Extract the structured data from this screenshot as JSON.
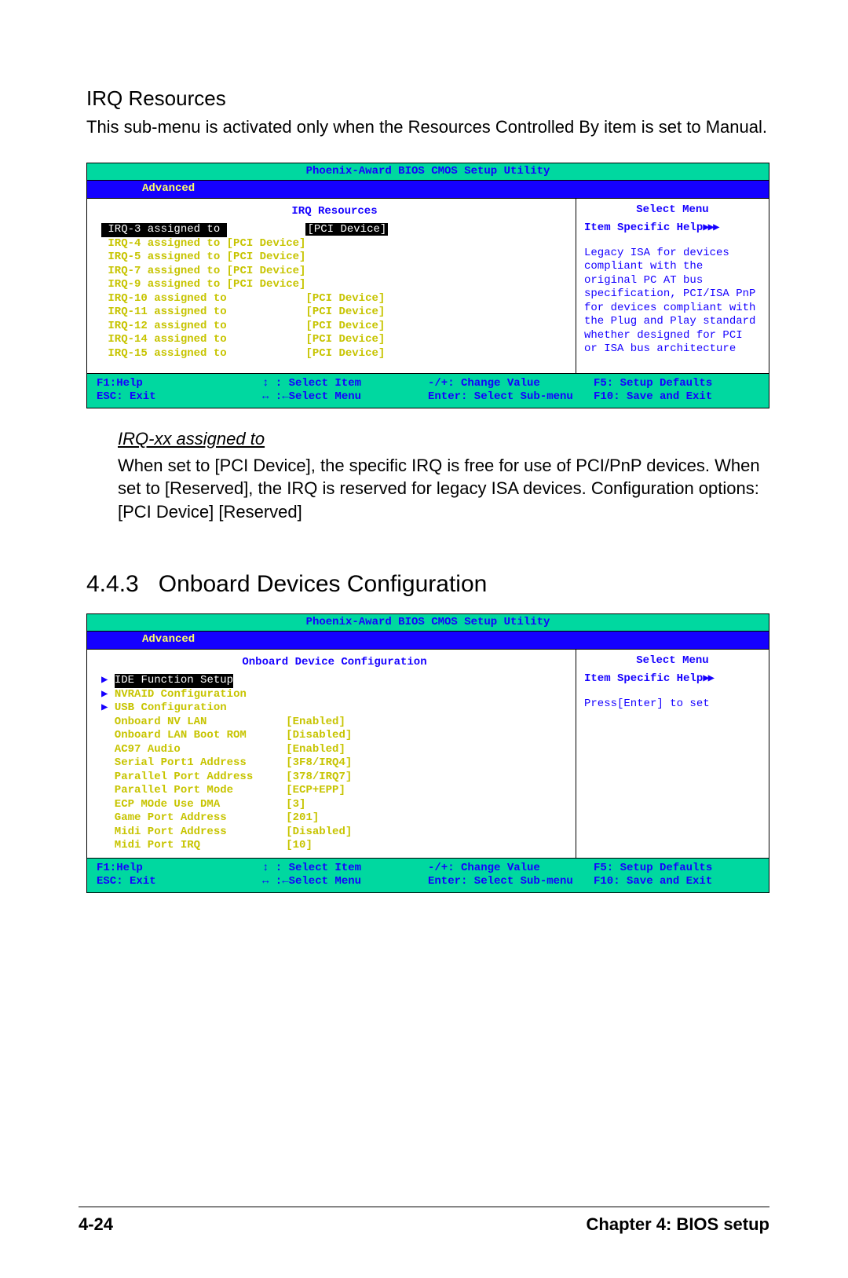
{
  "section1": {
    "title": "IRQ Resources",
    "intro": "This sub-menu is activated only when the Resources Controlled By item is set to Manual."
  },
  "bios_common": {
    "header": "Phoenix-Award BIOS CMOS Setup Utility",
    "tab": "Advanced",
    "right_title": "Select Menu",
    "help_head": "Item Specific Help"
  },
  "bios1": {
    "left_title": "IRQ Resources",
    "rows": [
      {
        "label": "IRQ-3 assigned to",
        "value": "PCI Device",
        "selected": true
      },
      {
        "label": "IRQ-4 assigned to",
        "value": "[PCI Device]",
        "selected": false,
        "yellow": true
      },
      {
        "label": "IRQ-5 assigned to",
        "value": "[PCI Device]",
        "selected": false,
        "yellow": true
      },
      {
        "label": "IRQ-7 assigned to",
        "value": "[PCI Device]",
        "selected": false,
        "yellow": true
      },
      {
        "label": "IRQ-9 assigned to",
        "value": "[PCI Device]",
        "selected": false,
        "yellow": true
      },
      {
        "label": "IRQ-10 assigned to",
        "value": "[PCI Device]",
        "selected": false,
        "yellow": false
      },
      {
        "label": "IRQ-11 assigned to",
        "value": "[PCI Device]",
        "selected": false,
        "yellow": false
      },
      {
        "label": "IRQ-12 assigned to",
        "value": "[PCI Device]",
        "selected": false,
        "yellow": false
      },
      {
        "label": "IRQ-14 assigned to",
        "value": "[PCI Device]",
        "selected": false,
        "yellow": false
      },
      {
        "label": "IRQ-15 assigned to",
        "value": "[PCI Device]",
        "selected": false,
        "yellow": false
      }
    ],
    "help_text": "Legacy ISA for devices compliant with the original PC AT bus specification, PCI/ISA PnP for devices compliant with the Plug and Play standard whether designed for PCI or ISA bus architecture"
  },
  "footer_keys": {
    "f1": "F1:Help",
    "sel_item": "↕ : Select Item",
    "change": "-/+: Change Value",
    "f5": "F5: Setup Defaults",
    "esc": "ESC: Exit",
    "sel_menu": "↔ :←Select Menu",
    "enter": "Enter: Select Sub-menu",
    "f10": "F10: Save and Exit"
  },
  "explain": {
    "title": "IRQ-xx assigned to",
    "body": "When set to [PCI Device], the specific IRQ is free for use of PCI/PnP devices. When set to [Reserved], the IRQ is reserved for legacy ISA devices. Configuration options: [PCI Device] [Reserved]"
  },
  "section2": {
    "number": "4.4.3",
    "title": "Onboard Devices Configuration"
  },
  "bios2": {
    "left_title": "Onboard Device Configuration",
    "submenus": [
      {
        "label": "IDE Function Setup",
        "selected": true
      },
      {
        "label": "NVRAID Configuration",
        "selected": false
      },
      {
        "label": "USB Configuration",
        "selected": false
      }
    ],
    "rows": [
      {
        "label": "Onboard NV LAN",
        "value": "[Enabled]"
      },
      {
        "label": "Onboard LAN Boot ROM",
        "value": "[Disabled]"
      },
      {
        "label": "AC97 Audio",
        "value": "[Enabled]"
      },
      {
        "label": "Serial Port1 Address",
        "value": "[3F8/IRQ4]"
      },
      {
        "label": "Parallel Port Address",
        "value": "[378/IRQ7]"
      },
      {
        "label": "Parallel Port Mode",
        "value": "[ECP+EPP]"
      },
      {
        "label": "ECP MOde Use DMA",
        "value": "[3]"
      },
      {
        "label": "Game Port Address",
        "value": "[201]"
      },
      {
        "label": "Midi Port Address",
        "value": "[Disabled]"
      },
      {
        "label": "Midi Port IRQ",
        "value": "[10]"
      }
    ],
    "help_text": "Press[Enter] to set"
  },
  "page_footer": {
    "left": "4-24",
    "right": "Chapter 4: BIOS setup"
  }
}
